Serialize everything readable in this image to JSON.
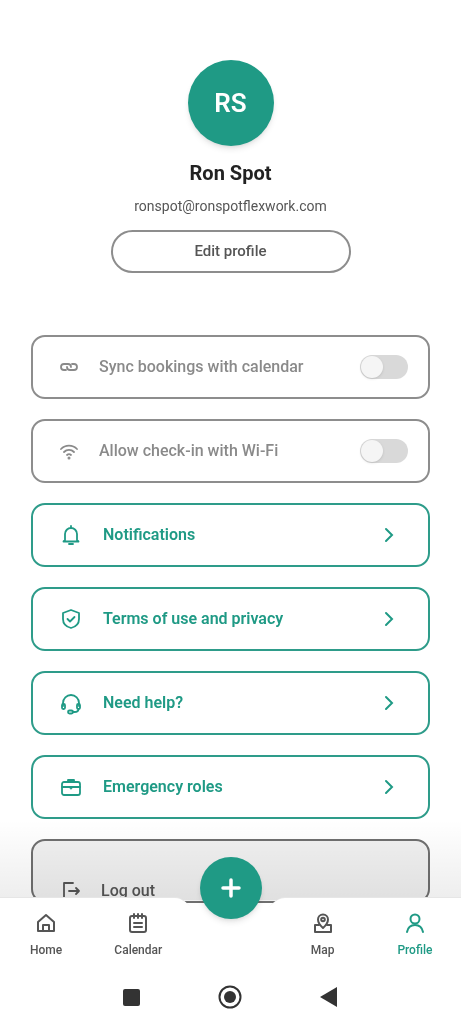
{
  "profile": {
    "initials": "RS",
    "name": "Ron Spot",
    "email": "ronspot@ronspotflexwork.com",
    "edit_button": "Edit profile"
  },
  "items": [
    {
      "kind": "toggle",
      "label": "Sync bookings with calendar",
      "on": false
    },
    {
      "kind": "toggle",
      "label": "Allow check-in with Wi-Fi",
      "on": false
    },
    {
      "kind": "link",
      "label": "Notifications"
    },
    {
      "kind": "link",
      "label": "Terms of use and privacy"
    },
    {
      "kind": "link",
      "label": "Need help?"
    },
    {
      "kind": "link",
      "label": "Emergency roles"
    },
    {
      "kind": "action",
      "label": "Log out"
    }
  ],
  "bottom_nav": [
    {
      "kind": "tab",
      "label": "Home",
      "selected": false
    },
    {
      "kind": "tab",
      "label": "Calendar",
      "selected": false
    },
    {
      "kind": "fab"
    },
    {
      "kind": "tab",
      "label": "Map",
      "selected": false
    },
    {
      "kind": "tab",
      "label": "Profile",
      "selected": true
    }
  ]
}
